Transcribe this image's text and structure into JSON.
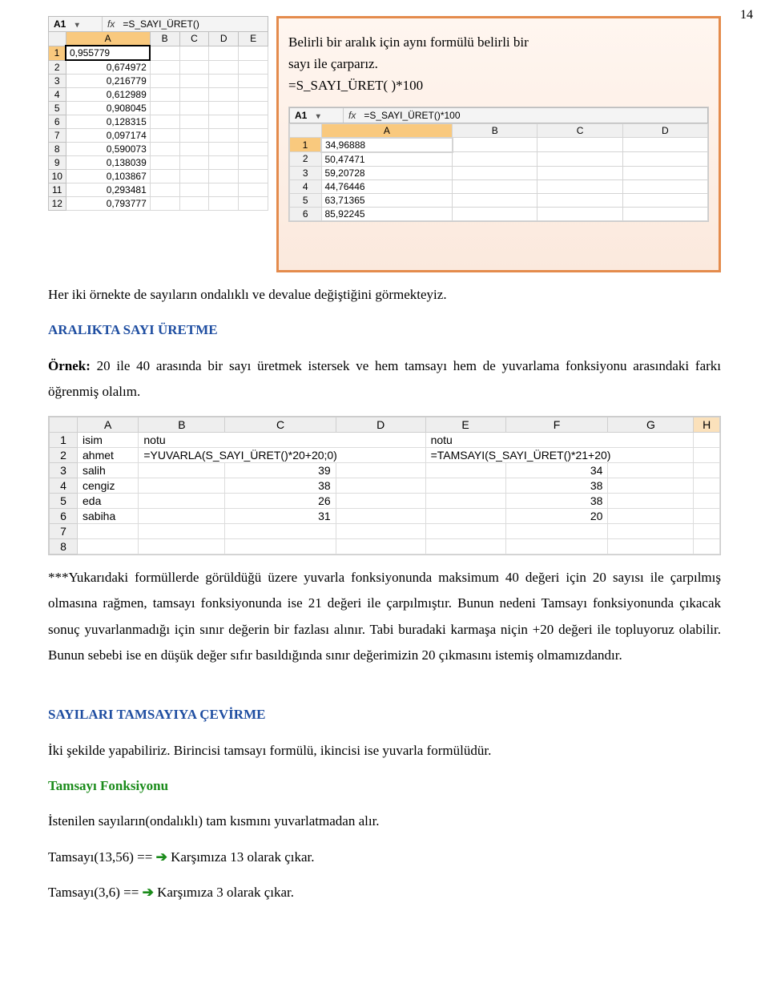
{
  "page_number": "14",
  "left_sheet": {
    "namebox": "A1",
    "formula": "=S_SAYI_ÜRET()",
    "columns": [
      "A",
      "B",
      "C",
      "D",
      "E"
    ],
    "rows": [
      {
        "n": "1",
        "a": "0,955779"
      },
      {
        "n": "2",
        "a": "0,674972"
      },
      {
        "n": "3",
        "a": "0,216779"
      },
      {
        "n": "4",
        "a": "0,612989"
      },
      {
        "n": "5",
        "a": "0,908045"
      },
      {
        "n": "6",
        "a": "0,128315"
      },
      {
        "n": "7",
        "a": "0,097174"
      },
      {
        "n": "8",
        "a": "0,590073"
      },
      {
        "n": "9",
        "a": "0,138039"
      },
      {
        "n": "10",
        "a": "0,103867"
      },
      {
        "n": "11",
        "a": "0,293481"
      },
      {
        "n": "12",
        "a": "0,793777"
      }
    ]
  },
  "callout": {
    "line1": "Belirli bir aralık için aynı formülü belirli bir",
    "line2": "sayı ile çarparız.",
    "line3": "=S_SAYI_ÜRET( )*100",
    "sheet": {
      "namebox": "A1",
      "formula": "=S_SAYI_ÜRET()*100",
      "columns": [
        "A",
        "B",
        "C",
        "D"
      ],
      "rows": [
        {
          "n": "1",
          "a": "34,96888"
        },
        {
          "n": "2",
          "a": "50,47471"
        },
        {
          "n": "3",
          "a": "59,20728"
        },
        {
          "n": "4",
          "a": "44,76446"
        },
        {
          "n": "5",
          "a": "63,71365"
        },
        {
          "n": "6",
          "a": "85,92245"
        }
      ]
    }
  },
  "p1": "Her iki örnekte de  sayıların ondalıklı ve devalue değiştiğini görmekteyiz.",
  "heading1": "ARALIKTA SAYI ÜRETME",
  "p2a": "Örnek:",
  "p2b": " 20 ile 40 arasında bir sayı üretmek istersek ve hem tamsayı hem de yuvarlama fonksiyonu arasındaki farkı öğrenmiş olalım.",
  "wide_sheet": {
    "columns": [
      "A",
      "B",
      "C",
      "D",
      "E",
      "F",
      "G",
      "H"
    ],
    "rows": [
      {
        "n": "1",
        "cells": [
          "isim",
          "notu",
          "",
          "",
          "notu",
          "",
          "",
          ""
        ]
      },
      {
        "n": "2",
        "cells": [
          "ahmet",
          "=YUVARLA(S_SAYI_ÜRET()*20+20;0)",
          "",
          "",
          "=TAMSAYI(S_SAYI_ÜRET()*21+20)",
          "",
          "",
          ""
        ]
      },
      {
        "n": "3",
        "cells": [
          "salih",
          "",
          "39",
          "",
          "",
          "34",
          "",
          ""
        ]
      },
      {
        "n": "4",
        "cells": [
          "cengiz",
          "",
          "38",
          "",
          "",
          "38",
          "",
          ""
        ]
      },
      {
        "n": "5",
        "cells": [
          "eda",
          "",
          "26",
          "",
          "",
          "38",
          "",
          ""
        ]
      },
      {
        "n": "6",
        "cells": [
          "sabiha",
          "",
          "31",
          "",
          "",
          "20",
          "",
          ""
        ]
      },
      {
        "n": "7",
        "cells": [
          "",
          "",
          "",
          "",
          "",
          "",
          "",
          ""
        ]
      },
      {
        "n": "8",
        "cells": [
          "",
          "",
          "",
          "",
          "",
          "",
          "",
          ""
        ]
      }
    ]
  },
  "p3": "***Yukarıdaki formüllerde görüldüğü üzere yuvarla fonksiyonunda maksimum 40 değeri için 20 sayısı ile çarpılmış olmasına rağmen, tamsayı fonksiyonunda ise 21 değeri ile çarpılmıştır. Bunun nedeni Tamsayı fonksiyonunda çıkacak  sonuç yuvarlanmadığı için sınır değerin bir fazlası alınır. Tabi buradaki karmaşa niçin +20 değeri ile topluyoruz olabilir. Bunun sebebi ise en düşük değer sıfır basıldığında sınır değerimizin 20 çıkmasını istemiş olmamızdandır.",
  "heading2": "SAYILARI TAMSAYIYA ÇEVİRME",
  "p4": "İki şekilde yapabiliriz. Birincisi tamsayı formülü, ikincisi ise yuvarla formülüdür.",
  "heading3": "Tamsayı Fonksiyonu",
  "p5": "İstenilen sayıların(ondalıklı) tam kısmını yuvarlatmadan alır.",
  "p6a": "Tamsayı(13,56)   ==",
  "p6b": "Karşımıza 13 olarak çıkar.",
  "p7a": "Tamsayı(3,6)   ==",
  "p7b": "Karşımıza 3 olarak çıkar.",
  "arrow": "➔"
}
